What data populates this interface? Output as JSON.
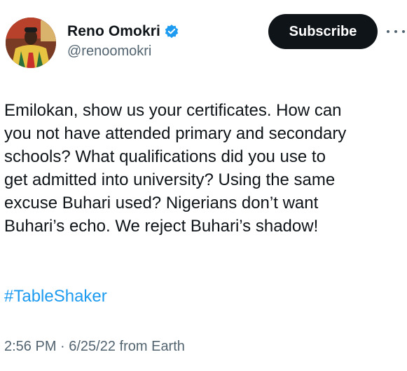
{
  "author": {
    "display_name": "Reno Omokri",
    "handle": "@renoomokri",
    "verified_color": "#1d9bf0"
  },
  "actions": {
    "subscribe_label": "Subscribe",
    "more_icon": "more-horizontal-icon"
  },
  "tweet": {
    "lines": [
      "Emilokan, show us your certificates. How can",
      "you not have attended primary and secondary",
      "schools? What qualifications did you use to",
      "get admitted into university? Using the same",
      "excuse Buhari used? Nigerians don’t want",
      "Buhari’s echo. We reject Buhari’s shadow!"
    ],
    "hashtag": "#TableShaker",
    "timestamp": "2:56 PM · 6/25/22 from Earth"
  },
  "colors": {
    "link": "#1d9bf0",
    "text": "#0f1419",
    "secondary": "#536471",
    "button_bg": "#0f1419"
  }
}
